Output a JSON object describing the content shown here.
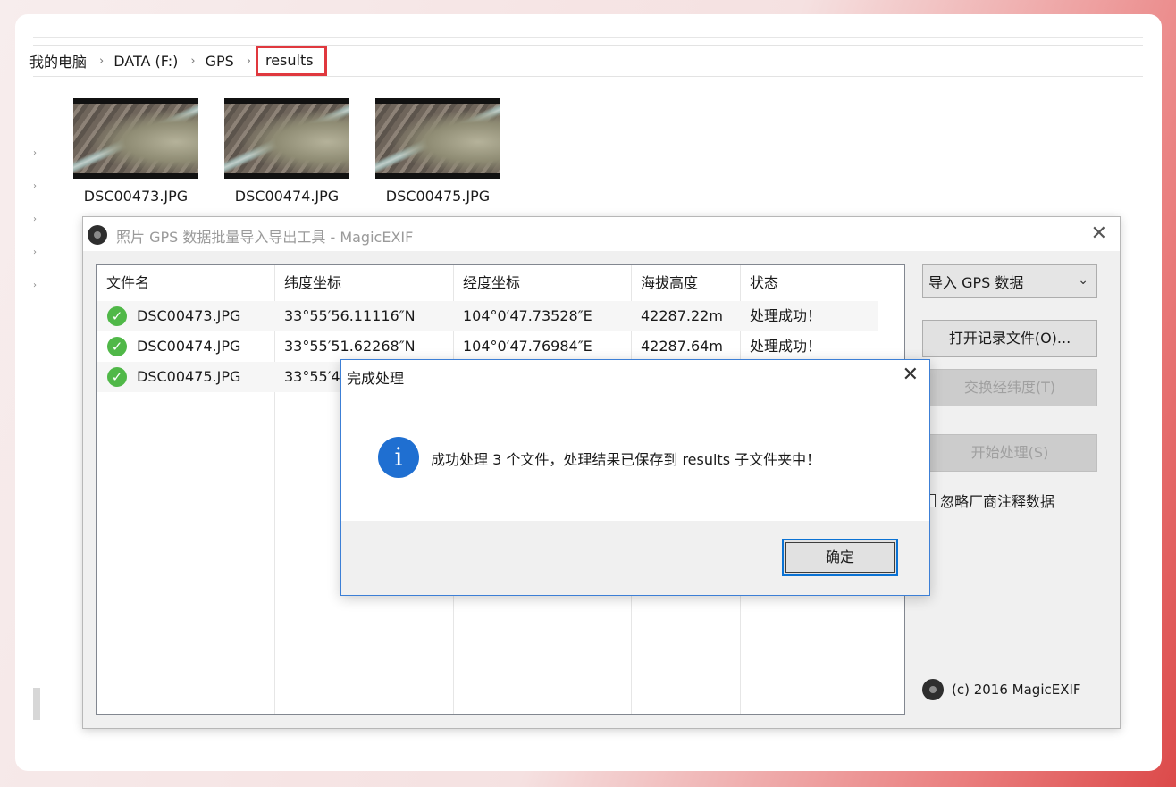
{
  "explorer": {
    "breadcrumb": [
      "我的电脑",
      "DATA (F:)",
      "GPS",
      "results"
    ],
    "files": [
      "DSC00473.JPG",
      "DSC00474.JPG",
      "DSC00475.JPG"
    ]
  },
  "app": {
    "title": "照片 GPS 数据批量导入导出工具 - MagicEXIF",
    "columns": [
      "文件名",
      "纬度坐标",
      "经度坐标",
      "海拔高度",
      "状态"
    ],
    "rows": [
      {
        "file": "DSC00473.JPG",
        "lat": "33°55′56.11116″N",
        "lon": "104°0′47.73528″E",
        "alt": "42287.22m",
        "status": "处理成功！"
      },
      {
        "file": "DSC00474.JPG",
        "lat": "33°55′51.62268″N",
        "lon": "104°0′47.76984″E",
        "alt": "42287.64m",
        "status": "处理成功！"
      },
      {
        "file": "DSC00475.JPG",
        "lat": "33°55′4",
        "lon": "",
        "alt": "",
        "status": ""
      }
    ],
    "mode_select": "导入 GPS 数据",
    "open_log_button": "打开记录文件(O)...",
    "swap_button": "交换经纬度(T)",
    "start_button": "开始处理(S)",
    "ignore_vendor_label": "忽略厂商注释数据",
    "copyright": "(c) 2016 MagicEXIF"
  },
  "dialog": {
    "title": "完成处理",
    "message": "成功处理 3 个文件，处理结果已保存到 results 子文件夹中！",
    "ok_label": "确定"
  }
}
